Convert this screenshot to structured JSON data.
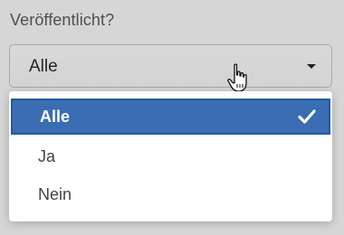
{
  "field": {
    "label": "Veröffentlicht?",
    "value": "Alle"
  },
  "dropdown": {
    "options": [
      {
        "label": "Alle",
        "selected": true
      },
      {
        "label": "Ja",
        "selected": false
      },
      {
        "label": "Nein",
        "selected": false
      }
    ]
  },
  "icons": {
    "caret": "chevron-down-icon",
    "check": "check-icon",
    "cursor": "hand-pointer-icon"
  },
  "colors": {
    "selected_bg": "#3a6db1",
    "selected_text": "#ffffff"
  }
}
